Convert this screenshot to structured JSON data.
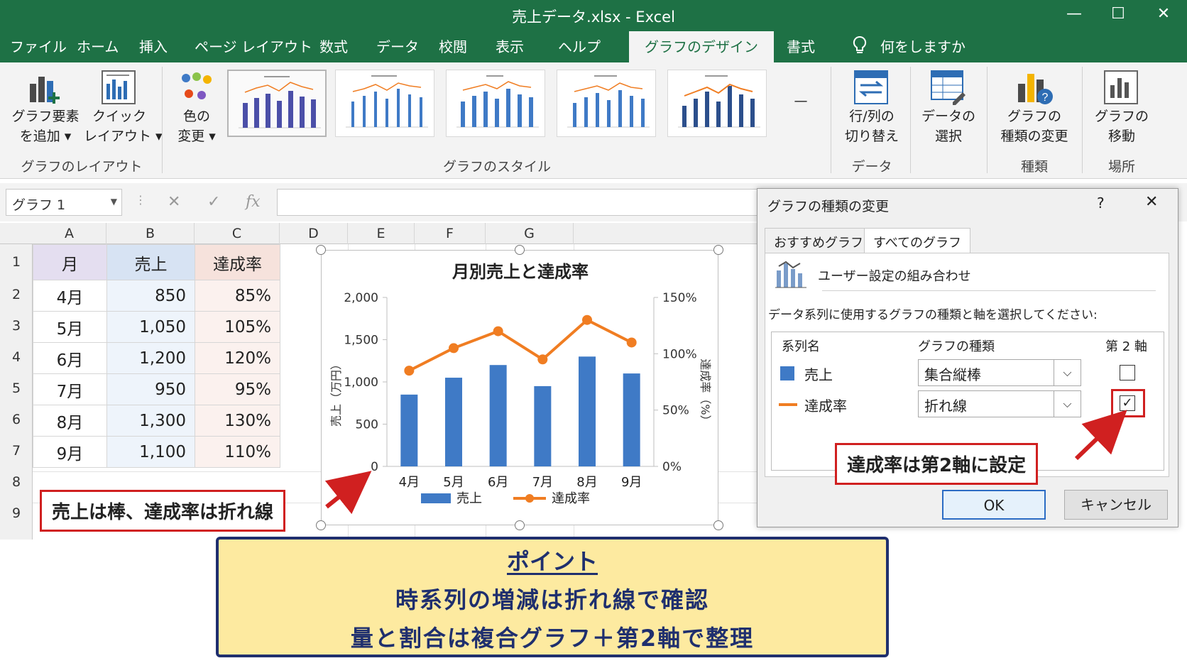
{
  "window": {
    "title": "売上データ.xlsx  -  Excel",
    "minimize": "—",
    "maximize": "☐",
    "close": "✕"
  },
  "menu": {
    "tabs": [
      "ファイル",
      "ホーム",
      "挿入",
      "ページ レイアウト",
      "数式",
      "データ",
      "校閲",
      "表示",
      "ヘルプ",
      "グラフのデザイン",
      "書式"
    ],
    "active_tab": "グラフのデザイン",
    "tell_me": "何をしますか"
  },
  "ribbon": {
    "add_element": [
      "グラフ要素",
      "を追加 ▾"
    ],
    "quick_layout": [
      "クイック",
      "レイアウト ▾"
    ],
    "layout_group": "グラフのレイアウト",
    "change_colors": [
      "色の",
      "変更 ▾"
    ],
    "styles_group": "グラフのスタイル",
    "switch_row_col": [
      "行/列の",
      "切り替え"
    ],
    "select_data": [
      "データの",
      "選択"
    ],
    "data_group": "データ",
    "change_type": [
      "グラフの",
      "種類の変更"
    ],
    "type_group": "種類",
    "move_chart": [
      "グラフの",
      "移動"
    ],
    "location_group": "場所",
    "more_styles": "—"
  },
  "formula_bar": {
    "name_box": "グラフ 1",
    "cancel": "✕",
    "enter": "✓",
    "fx": "fx",
    "formula": ""
  },
  "sheet": {
    "columns": [
      "A",
      "B",
      "C",
      "D",
      "E",
      "F",
      "G"
    ],
    "rows": [
      "1",
      "2",
      "3",
      "4",
      "5",
      "6",
      "7",
      "8",
      "9"
    ],
    "headers": [
      "月",
      "売上",
      "達成率"
    ],
    "data": [
      [
        "4月",
        "850",
        "85%"
      ],
      [
        "5月",
        "1,050",
        "105%"
      ],
      [
        "6月",
        "1,200",
        "120%"
      ],
      [
        "7月",
        "950",
        "95%"
      ],
      [
        "8月",
        "1,300",
        "130%"
      ],
      [
        "9月",
        "1,100",
        "110%"
      ]
    ]
  },
  "chart_data": {
    "type": "bar",
    "title": "月別売上と達成率",
    "categories": [
      "4月",
      "5月",
      "6月",
      "7月",
      "8月",
      "9月"
    ],
    "series": [
      {
        "name": "売上",
        "type": "bar",
        "axis": "primary",
        "values": [
          850,
          1050,
          1200,
          950,
          1300,
          1100
        ],
        "color": "#3f7ac6"
      },
      {
        "name": "達成率",
        "type": "line",
        "axis": "secondary",
        "values": [
          85,
          105,
          120,
          95,
          130,
          110
        ],
        "color": "#f07d22"
      }
    ],
    "ylabel": "売上（万円）",
    "y2label": "達成率（%）",
    "ylim": [
      0,
      2000
    ],
    "y2lim": [
      0,
      150
    ],
    "yticks": [
      "0",
      "500",
      "1,000",
      "1,500",
      "2,000"
    ],
    "y2ticks": [
      "0%",
      "50%",
      "100%",
      "150%"
    ],
    "legend": "bottom"
  },
  "dialog": {
    "title": "グラフの種類の変更",
    "help": "?",
    "close": "✕",
    "tabs": [
      "おすすめグラフ",
      "すべてのグラフ"
    ],
    "active_tab": "すべてのグラフ",
    "combo_title": "ユーザー設定の組み合わせ",
    "instruction": "データ系列に使用するグラフの種類と軸を選択してください:",
    "col_series": "系列名",
    "col_type": "グラフの種類",
    "col_axis": "第 2 軸",
    "rows": [
      {
        "name": "売上",
        "type": "集合縦棒",
        "secondary": false,
        "color": "#3f7ac6"
      },
      {
        "name": "達成率",
        "type": "折れ線",
        "secondary": true,
        "color": "#f07d22"
      }
    ],
    "ok": "OK",
    "cancel": "キャンセル"
  },
  "callouts": {
    "left": "売上は棒、達成率は折れ線",
    "right": "達成率は第2軸に設定"
  },
  "point": {
    "title": "ポイント",
    "line1": "時系列の増減は折れ線で確認",
    "line2": "量と割合は複合グラフ＋第2軸で整理"
  },
  "colors": {
    "excel_green": "#1e7145",
    "accent_red": "#d02020",
    "navy": "#1f2f6e"
  }
}
